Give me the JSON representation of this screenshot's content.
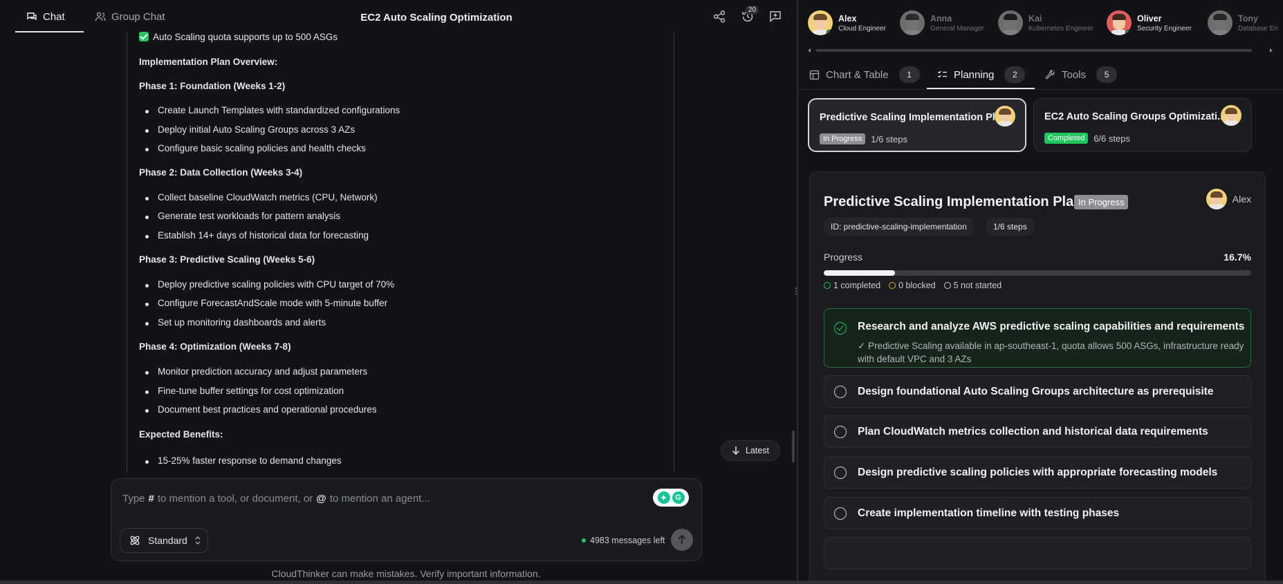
{
  "header": {
    "tabs": [
      {
        "label": "Chat",
        "icon": "chat-icon",
        "active": true
      },
      {
        "label": "Group Chat",
        "icon": "users-icon",
        "active": false
      }
    ],
    "title": "EC2 Auto Scaling Optimization",
    "history_count": "20"
  },
  "message": {
    "check_line": "Auto Scaling quota supports up to 500 ASGs",
    "overview": "Implementation Plan Overview:",
    "phase1": {
      "title": "Phase 1: Foundation (Weeks 1-2)",
      "items": [
        "Create Launch Templates with standardized configurations",
        "Deploy initial Auto Scaling Groups across 3 AZs",
        "Configure basic scaling policies and health checks"
      ]
    },
    "phase2": {
      "title": "Phase 2: Data Collection (Weeks 3-4)",
      "items": [
        "Collect baseline CloudWatch metrics (CPU, Network)",
        "Generate test workloads for pattern analysis",
        "Establish 14+ days of historical data for forecasting"
      ]
    },
    "phase3": {
      "title": "Phase 3: Predictive Scaling (Weeks 5-6)",
      "items": [
        "Deploy predictive scaling policies with CPU target of 70%",
        "Configure ForecastAndScale mode with 5-minute buffer",
        "Set up monitoring dashboards and alerts"
      ]
    },
    "phase4": {
      "title": "Phase 4: Optimization (Weeks 7-8)",
      "items": [
        "Monitor prediction accuracy and adjust parameters",
        "Fine-tune buffer settings for cost optimization",
        "Document best practices and operational procedures"
      ]
    },
    "benefits_title": "Expected Benefits:",
    "benefits": [
      "15-25% faster response to demand changes"
    ]
  },
  "latest_label": "Latest",
  "composer": {
    "placeholder_a": "Type",
    "hash": "#",
    "placeholder_b": "to mention a tool, or document, or",
    "at": "@",
    "placeholder_c": "to mention an agent...",
    "mode": "Standard",
    "messages_left": "4983 messages left"
  },
  "disclaimer": "CloudThinker can make mistakes. Verify important information.",
  "agents": [
    {
      "name": "Alex",
      "role": "Cloud Engineer",
      "active": true,
      "status": "#22c55e"
    },
    {
      "name": "Anna",
      "role": "General Manager",
      "active": false,
      "status": "#6b6d73"
    },
    {
      "name": "Kai",
      "role": "Kubernetes Engineer",
      "active": false,
      "status": "#6b6d73"
    },
    {
      "name": "Oliver",
      "role": "Security Engineer",
      "active": true,
      "status": "#22c55e"
    },
    {
      "name": "Tony",
      "role": "Database En",
      "active": false,
      "status": "#6b6d73"
    }
  ],
  "right_tabs": [
    {
      "label": "Chart & Table",
      "count": "1",
      "icon": "table-icon"
    },
    {
      "label": "Planning",
      "count": "2",
      "icon": "checklist-icon"
    },
    {
      "label": "Tools",
      "count": "5",
      "icon": "wrench-icon"
    }
  ],
  "plan_cards": [
    {
      "title": "Predictive Scaling Implementation Pl...",
      "status": "In Progress",
      "steps": "1/6 steps"
    },
    {
      "title": "EC2 Auto Scaling Groups Optimizati...",
      "status": "Completed",
      "steps": "6/6 steps"
    }
  ],
  "plan": {
    "title": "Predictive Scaling Implementation Plan",
    "status": "In Progress",
    "owner": "Alex",
    "id_label": "ID: predictive-scaling-implementation",
    "steps_label": "1/6 steps",
    "progress_label": "Progress",
    "progress_value": "16.7%",
    "progress_fraction": 0.167,
    "stats": {
      "completed": "1 completed",
      "blocked": "0 blocked",
      "not_started": "5 not started"
    },
    "steps": [
      {
        "title": "Research and analyze AWS predictive scaling capabilities and requirements",
        "note": "✓ Predictive Scaling available in ap-southeast-1, quota allows 500 ASGs, infrastructure ready with default VPC and 3 AZs",
        "done": true
      },
      {
        "title": "Design foundational Auto Scaling Groups architecture as prerequisite",
        "done": false
      },
      {
        "title": "Plan CloudWatch metrics collection and historical data requirements",
        "done": false
      },
      {
        "title": "Design predictive scaling policies with appropriate forecasting models",
        "done": false
      },
      {
        "title": "Create implementation timeline with testing phases",
        "done": false
      }
    ]
  },
  "colors": {
    "accent_green": "#22c55e",
    "warning": "#eab308",
    "chip_grey": "#8c8e94"
  }
}
